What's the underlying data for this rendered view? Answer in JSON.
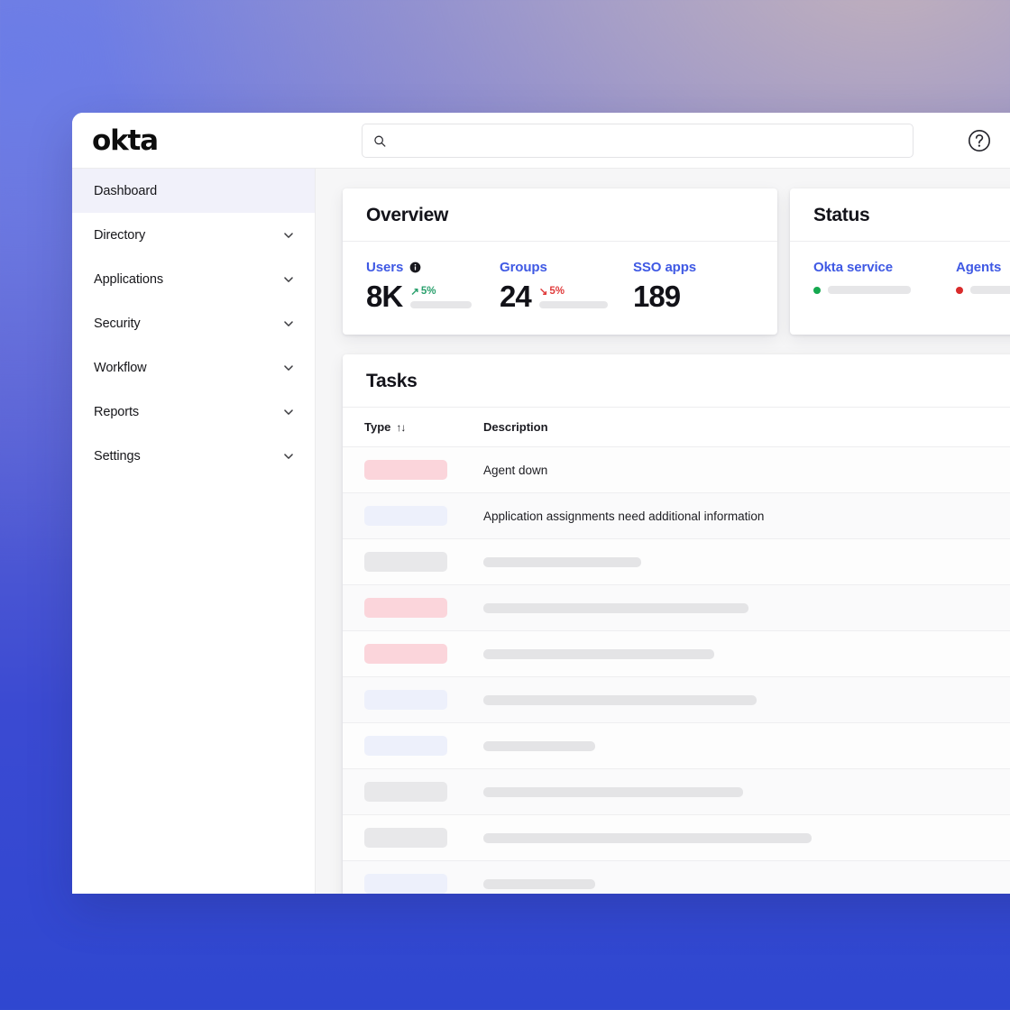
{
  "brand": {
    "logo_text": "okta"
  },
  "topbar": {
    "search": {
      "value": "",
      "placeholder": "",
      "icon": "search-icon"
    },
    "help": {
      "icon": "help-circle-icon",
      "label": "Help"
    }
  },
  "sidebar": {
    "items": [
      {
        "label": "Dashboard",
        "active": true,
        "chevron": false
      },
      {
        "label": "Directory",
        "active": false,
        "chevron": true
      },
      {
        "label": "Applications",
        "active": false,
        "chevron": true
      },
      {
        "label": "Security",
        "active": false,
        "chevron": true
      },
      {
        "label": "Workflow",
        "active": false,
        "chevron": true
      },
      {
        "label": "Reports",
        "active": false,
        "chevron": true
      },
      {
        "label": "Settings",
        "active": false,
        "chevron": true
      }
    ]
  },
  "overview": {
    "title": "Overview",
    "metrics": [
      {
        "label": "Users",
        "value": "8K",
        "delta": "5%",
        "direction": "up",
        "arrow": "↗",
        "has_info": true,
        "has_bar": true
      },
      {
        "label": "Groups",
        "value": "24",
        "delta": "5%",
        "direction": "down",
        "arrow": "↘",
        "has_info": false,
        "has_bar": true
      },
      {
        "label": "SSO apps",
        "value": "189",
        "delta": "",
        "direction": "",
        "arrow": "",
        "has_info": false,
        "has_bar": false
      }
    ]
  },
  "status": {
    "title": "Status",
    "services": [
      {
        "name": "Okta service",
        "state": "ok",
        "color": "#15a84f"
      },
      {
        "name": "Agents",
        "state": "error",
        "color": "#d92b2b"
      }
    ]
  },
  "tasks": {
    "title": "Tasks",
    "columns": {
      "type": "Type",
      "description": "Description",
      "sort_icon": "↑↓"
    },
    "rows": [
      {
        "pill_color": "#fbd5db",
        "description": "Agent down",
        "desc_placeholder": false,
        "desc_width": 0
      },
      {
        "pill_color": "#edf0fb",
        "description": "Application assignments need additional information",
        "desc_placeholder": false,
        "desc_width": 0
      },
      {
        "pill_color": "#e8e8ea",
        "description": "",
        "desc_placeholder": true,
        "desc_width": 175
      },
      {
        "pill_color": "#fbd5db",
        "description": "",
        "desc_placeholder": true,
        "desc_width": 294
      },
      {
        "pill_color": "#fbd5db",
        "description": "",
        "desc_placeholder": true,
        "desc_width": 256
      },
      {
        "pill_color": "#edf0fb",
        "description": "",
        "desc_placeholder": true,
        "desc_width": 303
      },
      {
        "pill_color": "#edf0fb",
        "description": "",
        "desc_placeholder": true,
        "desc_width": 124
      },
      {
        "pill_color": "#e8e8ea",
        "description": "",
        "desc_placeholder": true,
        "desc_width": 288
      },
      {
        "pill_color": "#e8e8ea",
        "description": "",
        "desc_placeholder": true,
        "desc_width": 364
      },
      {
        "pill_color": "#edf0fb",
        "description": "",
        "desc_placeholder": true,
        "desc_width": 124
      }
    ]
  },
  "colors": {
    "accent_blue": "#3f59e4",
    "up_green": "#2aa06d",
    "down_red": "#e03b3b",
    "status_ok": "#15a84f",
    "status_error": "#d92b2b",
    "content_bg": "#f6f6f7",
    "active_nav_bg": "#f1f1fa"
  }
}
